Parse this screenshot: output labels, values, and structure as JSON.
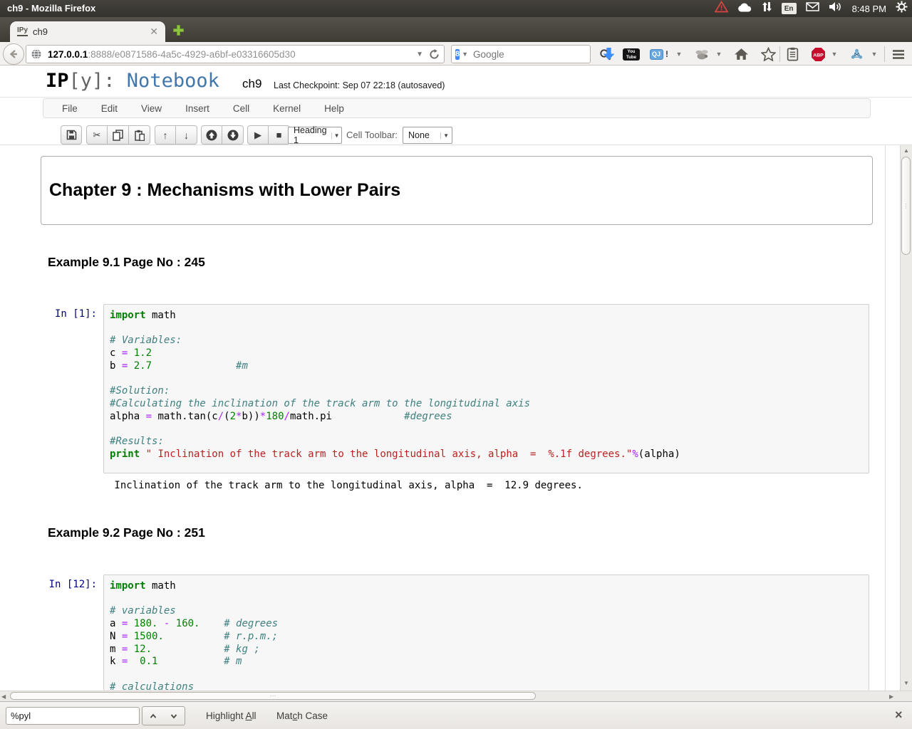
{
  "window": {
    "title": "ch9 - Mozilla Firefox",
    "time": "8:48 PM",
    "keyboard_layout": "En"
  },
  "browser": {
    "tab": {
      "favicon_text": "IPy",
      "title": "ch9"
    },
    "url": {
      "host": "127.0.0.1",
      "rest": ":8888/e0871586-4a5c-4929-a6bf-e03316605d30"
    },
    "search": {
      "placeholder": "Google",
      "engine_badge": "8"
    },
    "badges": {
      "youtube_line1": "You",
      "youtube_line2": "Tube",
      "qj": "QJ",
      "qj_bang": "!",
      "abp": "ABP"
    }
  },
  "notebook": {
    "logo": {
      "ip": "IP",
      "y": "[y]:",
      "word": " Notebook"
    },
    "title": "ch9",
    "checkpoint": "Last Checkpoint: Sep 07 22:18 (autosaved)",
    "menus": [
      "File",
      "Edit",
      "View",
      "Insert",
      "Cell",
      "Kernel",
      "Help"
    ],
    "toolbar": {
      "cell_type_value": "Heading 1",
      "cell_toolbar_label": "Cell Toolbar:",
      "cell_toolbar_value": "None"
    },
    "heading_cell": "Chapter 9 : Mechanisms with Lower Pairs",
    "example1_heading": "Example 9.1 Page No : 245",
    "cell1": {
      "prompt": "In [1]:",
      "code": [
        [
          [
            "kw",
            "import"
          ],
          [
            "p",
            " math"
          ]
        ],
        [],
        [
          [
            "cm",
            "# Variables:"
          ]
        ],
        [
          [
            "p",
            "c "
          ],
          [
            "op",
            "="
          ],
          [
            "p",
            " "
          ],
          [
            "num",
            "1.2"
          ]
        ],
        [
          [
            "p",
            "b "
          ],
          [
            "op",
            "="
          ],
          [
            "p",
            " "
          ],
          [
            "num",
            "2.7"
          ],
          [
            "p",
            "              "
          ],
          [
            "cm",
            "#m"
          ]
        ],
        [],
        [
          [
            "cm",
            "#Solution:"
          ]
        ],
        [
          [
            "cm",
            "#Calculating the inclination of the track arm to the longitudinal axis"
          ]
        ],
        [
          [
            "p",
            "alpha "
          ],
          [
            "op",
            "="
          ],
          [
            "p",
            " math.tan(c"
          ],
          [
            "op",
            "/"
          ],
          [
            "p",
            "("
          ],
          [
            "num",
            "2"
          ],
          [
            "op",
            "*"
          ],
          [
            "p",
            "b))"
          ],
          [
            "op",
            "*"
          ],
          [
            "num",
            "180"
          ],
          [
            "op",
            "/"
          ],
          [
            "p",
            "math.pi            "
          ],
          [
            "cm",
            "#degrees"
          ]
        ],
        [],
        [
          [
            "cm",
            "#Results:"
          ]
        ],
        [
          [
            "kw",
            "print"
          ],
          [
            "p",
            " "
          ],
          [
            "str",
            "\" Inclination of the track arm to the longitudinal axis, alpha  =  %.1f degrees.\""
          ],
          [
            "op",
            "%"
          ],
          [
            "p",
            "(alpha)"
          ]
        ]
      ],
      "output": " Inclination of the track arm to the longitudinal axis, alpha  =  12.9 degrees."
    },
    "example2_heading": "Example 9.2 Page No : 251",
    "cell2": {
      "prompt": "In [12]:",
      "code": [
        [
          [
            "kw",
            "import"
          ],
          [
            "p",
            " math"
          ]
        ],
        [],
        [
          [
            "cm",
            "# variables"
          ]
        ],
        [
          [
            "p",
            "a "
          ],
          [
            "op",
            "="
          ],
          [
            "p",
            " "
          ],
          [
            "num",
            "180."
          ],
          [
            "p",
            " "
          ],
          [
            "op",
            "-"
          ],
          [
            "p",
            " "
          ],
          [
            "num",
            "160."
          ],
          [
            "p",
            "    "
          ],
          [
            "cm",
            "# degrees"
          ]
        ],
        [
          [
            "p",
            "N "
          ],
          [
            "op",
            "="
          ],
          [
            "p",
            " "
          ],
          [
            "num",
            "1500."
          ],
          [
            "p",
            "          "
          ],
          [
            "cm",
            "# r.p.m.;"
          ]
        ],
        [
          [
            "p",
            "m "
          ],
          [
            "op",
            "="
          ],
          [
            "p",
            " "
          ],
          [
            "num",
            "12."
          ],
          [
            "p",
            "            "
          ],
          [
            "cm",
            "# kg ;"
          ]
        ],
        [
          [
            "p",
            "k "
          ],
          [
            "op",
            "="
          ],
          [
            "p",
            "  "
          ],
          [
            "num",
            "0.1"
          ],
          [
            "p",
            "           "
          ],
          [
            "cm",
            "# m"
          ]
        ],
        [],
        [
          [
            "cm",
            "# calculations"
          ]
        ]
      ]
    },
    "colors": {
      "prompt_blue": "#000080",
      "keyword_green": "#008000",
      "comment_teal": "#408080",
      "operator_purple": "#AA22FF",
      "string_red": "#BA2121",
      "logo_blue": "#4077ad"
    }
  },
  "findbar": {
    "query": "%pyl",
    "highlight_all": {
      "pre": "Highlight ",
      "key": "A",
      "post": "ll"
    },
    "match_case": {
      "pre": "Mat",
      "key": "c",
      "post": "h Case"
    }
  }
}
